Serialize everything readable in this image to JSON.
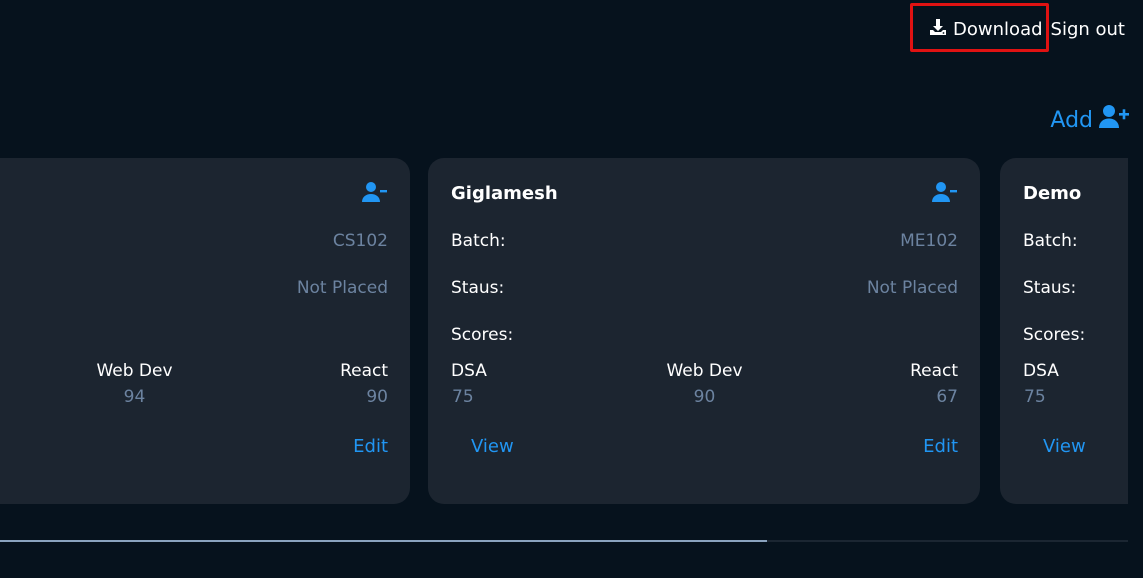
{
  "header": {
    "download_label": "Download",
    "signout_label": "Sign out"
  },
  "add_button": {
    "label": "Add"
  },
  "labels": {
    "batch": "Batch:",
    "status": "Staus:",
    "scores": "Scores:",
    "view": "View",
    "edit": "Edit"
  },
  "score_names": [
    "DSA",
    "Web Dev",
    "React"
  ],
  "cards": [
    {
      "name": "",
      "batch": "CS102",
      "status": "Not Placed",
      "scores": {
        "dsa": "",
        "webdev": "94",
        "react": "90"
      }
    },
    {
      "name": "Giglamesh",
      "batch": "ME102",
      "status": "Not Placed",
      "scores": {
        "dsa": "75",
        "webdev": "90",
        "react": "67"
      }
    },
    {
      "name": "Demo",
      "batch": "",
      "status": "",
      "scores": {
        "dsa": "75",
        "webdev": "",
        "react": ""
      }
    }
  ],
  "scroll": {
    "thumb_fraction": 0.68
  },
  "colors": {
    "background": "#06121d",
    "card": "#1c2530",
    "accent": "#2196f3",
    "muted_value": "#6c83a0",
    "highlight": "#e01212"
  },
  "icons": {
    "download": "download-icon",
    "add": "user-plus-icon",
    "remove": "user-minus-icon"
  }
}
